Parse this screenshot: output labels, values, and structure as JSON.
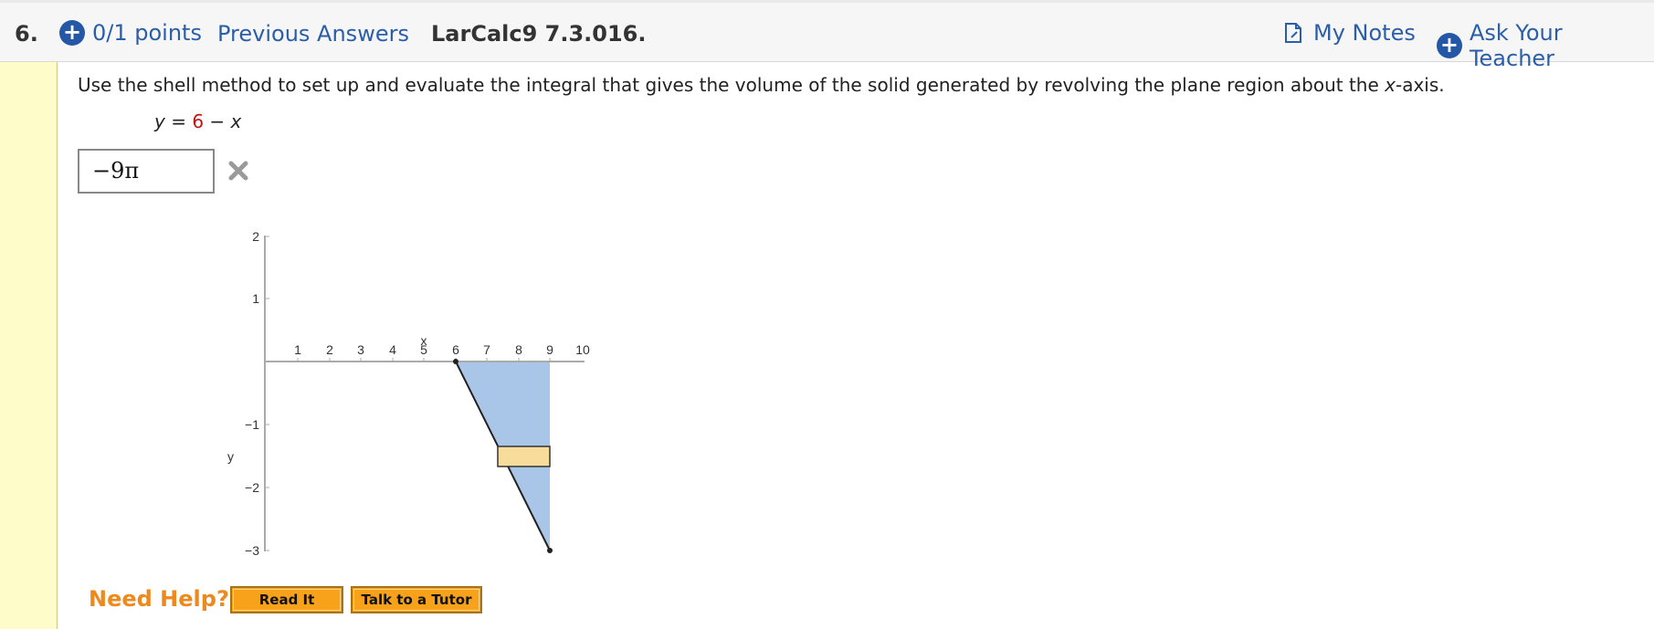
{
  "header": {
    "question_number": "6.",
    "points": "0/1 points",
    "previous_answers": "Previous Answers",
    "question_id": "LarCalc9 7.3.016.",
    "my_notes": "My Notes",
    "ask_teacher": "Ask Your Teacher"
  },
  "question": {
    "prompt_before": "Use the shell method to set up and evaluate the integral that gives the volume of the solid generated by revolving the plane region about the ",
    "prompt_var": "x",
    "prompt_after": "-axis.",
    "eq_lhs": "y",
    "eq_mid": " = ",
    "eq_const": "6",
    "eq_rest": " − ",
    "eq_var": "x",
    "answer_value": "−9π",
    "answer_status": "incorrect"
  },
  "graph": {
    "x_label": "x",
    "y_label": "y",
    "x_ticks": [
      "1",
      "2",
      "3",
      "4",
      "5",
      "6",
      "7",
      "8",
      "9",
      "10"
    ],
    "y_ticks": [
      "2",
      "1",
      "−1",
      "−2",
      "−3"
    ],
    "region_color": "#a9c6e8",
    "rect_color": "#f7dc9c"
  },
  "help": {
    "need_help": "Need Help?",
    "read_it": "Read It",
    "talk_tutor": "Talk to a Tutor"
  },
  "colors": {
    "link": "#2b5ea8",
    "accent_plus": "#2458a6",
    "help_orange": "#ee8a1d",
    "left_bar": "#fefdc9"
  }
}
